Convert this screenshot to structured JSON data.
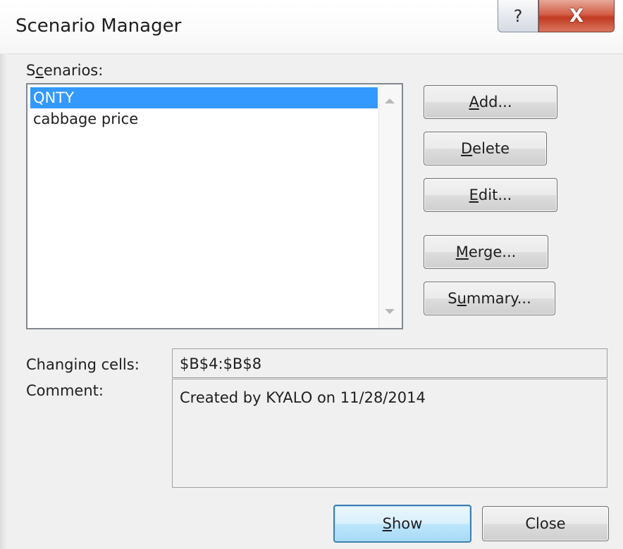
{
  "window": {
    "title": "Scenario Manager",
    "help_glyph": "?",
    "close_glyph": "X"
  },
  "scenarios": {
    "label_pre": "S",
    "label_key": "c",
    "label_post": "enarios:",
    "items": [
      {
        "label": "QNTY",
        "selected": true
      },
      {
        "label": "cabbage price",
        "selected": false
      }
    ]
  },
  "buttons": {
    "add": {
      "pre": "",
      "key": "A",
      "post": "dd..."
    },
    "delete": {
      "pre": "",
      "key": "D",
      "post": "elete"
    },
    "edit": {
      "pre": "",
      "key": "E",
      "post": "dit..."
    },
    "merge": {
      "pre": "",
      "key": "M",
      "post": "erge..."
    },
    "summary": {
      "pre": "S",
      "key": "u",
      "post": "mmary..."
    },
    "show": {
      "pre": "",
      "key": "S",
      "post": "how"
    },
    "close": {
      "label": "Close"
    }
  },
  "changing_cells": {
    "label": "Changing cells:",
    "value": "$B$4:$B$8"
  },
  "comment": {
    "label": "Comment:",
    "value": "Created by KYALO on 11/28/2014"
  },
  "colors": {
    "selection": "#3399ff",
    "close_button": "#c23a22",
    "dialog_bg": "#f0f0f0"
  }
}
